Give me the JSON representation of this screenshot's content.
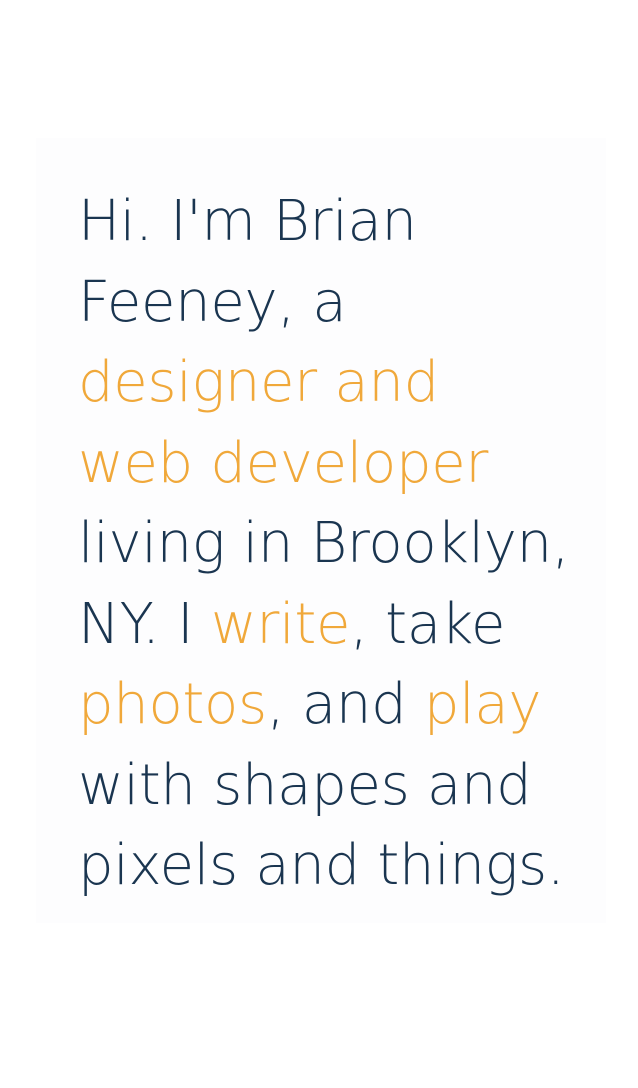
{
  "intro": {
    "line1": "Hi. I'm Brian",
    "line2": "Feeney, a",
    "line3": "designer and",
    "line4": "web developer",
    "line5": "living in Brooklyn,",
    "line6_a": "NY. I ",
    "line6_link": "write",
    "line6_b": ", take",
    "line7_link1": "photos",
    "line7_b": ", and ",
    "line7_link2": "play",
    "line8": "with shapes and",
    "line9": "pixels and things."
  },
  "colors": {
    "text": "#1a3550",
    "accent": "#f0a83a",
    "background": "#ffffff"
  }
}
